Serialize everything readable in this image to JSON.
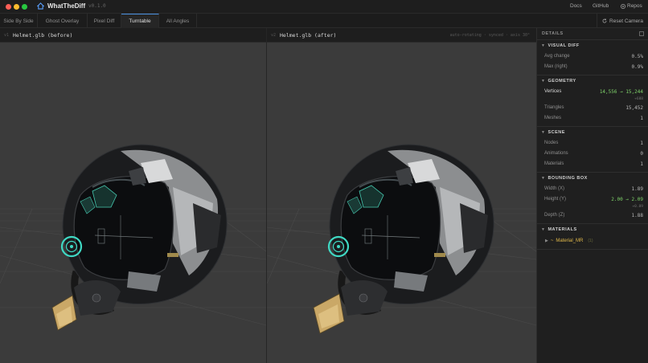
{
  "app": {
    "name": "WhatTheDiff",
    "version": "v0.1.0"
  },
  "top_links": {
    "docs": "Docs",
    "github": "GitHub",
    "repos": "Repos"
  },
  "tabs": [
    {
      "label": "Side By Side",
      "active": false
    },
    {
      "label": "Ghost Overlay",
      "active": false
    },
    {
      "label": "Pixel Diff",
      "active": false
    },
    {
      "label": "Turntable",
      "active": true
    },
    {
      "label": "All Angles",
      "active": false
    }
  ],
  "reset_camera": "Reset Camera",
  "panels": {
    "before": {
      "index": "v1",
      "name": "Helmet.glb (before)"
    },
    "after": {
      "index": "v2",
      "name": "Helmet.glb (after)",
      "status": "auto-rotating · synced · axis 30°"
    }
  },
  "details": {
    "title": "DETAILS",
    "visual_diff": {
      "title": "VISUAL DIFF",
      "avg_change_label": "Avg change",
      "avg_change": "0.5%",
      "max_right_label": "Max (right)",
      "max_right": "0.9%"
    },
    "geometry": {
      "title": "GEOMETRY",
      "vertices_label": "Vertices",
      "vertices": "14,556 → 15,244",
      "vertices_delta": "+688",
      "triangles_label": "Triangles",
      "triangles": "15,452",
      "meshes_label": "Meshes",
      "meshes": "1"
    },
    "scene": {
      "title": "SCENE",
      "nodes_label": "Nodes",
      "nodes": "1",
      "animations_label": "Animations",
      "animations": "0",
      "materials_label": "Materials",
      "materials": "1"
    },
    "bounding_box": {
      "title": "BOUNDING BOX",
      "width_label": "Width (X)",
      "width": "1.89",
      "height_label": "Height (Y)",
      "height": "2.00 → 2.09",
      "height_delta": "+0.09",
      "depth_label": "Depth (Z)",
      "depth": "1.88"
    },
    "materials": {
      "title": "MATERIALS",
      "item_modifier": "~",
      "item_name": "Material_MR",
      "item_count": "(1)"
    }
  },
  "colors": {
    "accent": "#4a90e2",
    "diff_green": "#7fd36a",
    "material_gold": "#e0b84a",
    "viewport_bg": "#3b3b3b"
  },
  "icons": {
    "logo": "house-logo-icon",
    "repos": "github-icon",
    "reset": "refresh-icon",
    "expand": "expand-icon",
    "section": "chevron-down-icon",
    "material": "chevron-right-icon"
  }
}
